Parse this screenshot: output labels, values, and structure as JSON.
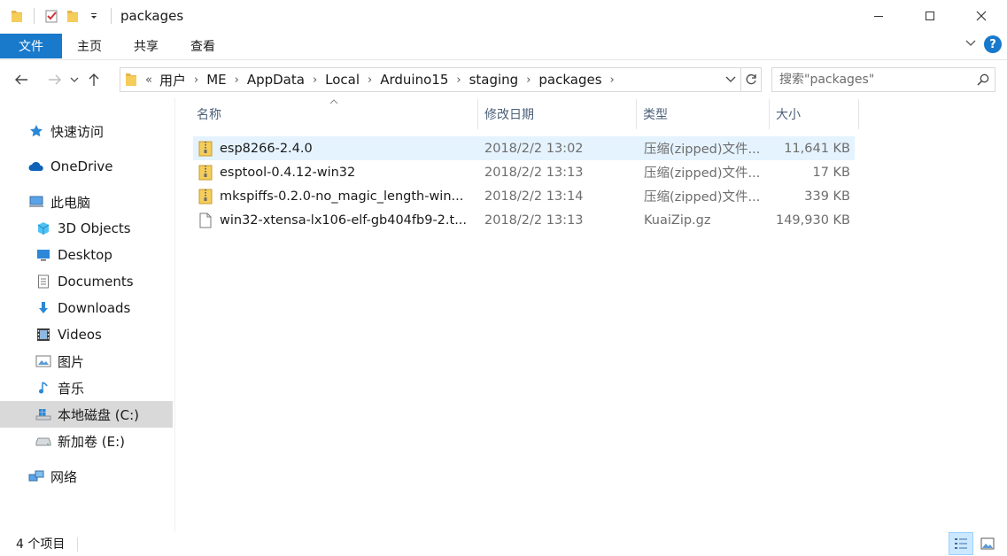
{
  "window": {
    "title": "packages"
  },
  "ribbon": {
    "tabs": [
      {
        "label": "文件"
      },
      {
        "label": "主页"
      },
      {
        "label": "共享"
      },
      {
        "label": "查看"
      }
    ],
    "help_label": "?"
  },
  "address": {
    "overflow": "«",
    "crumbs": [
      "用户",
      "ME",
      "AppData",
      "Local",
      "Arduino15",
      "staging",
      "packages"
    ]
  },
  "search": {
    "placeholder": "搜索\"packages\""
  },
  "sidebar": {
    "items": [
      {
        "label": "快速访问",
        "icon": "star-icon"
      },
      {
        "label": "OneDrive",
        "icon": "cloud-icon"
      },
      {
        "label": "此电脑",
        "icon": "computer-icon"
      },
      {
        "label": "3D Objects",
        "icon": "cube-icon"
      },
      {
        "label": "Desktop",
        "icon": "desktop-icon"
      },
      {
        "label": "Documents",
        "icon": "document-icon"
      },
      {
        "label": "Downloads",
        "icon": "download-icon"
      },
      {
        "label": "Videos",
        "icon": "film-icon"
      },
      {
        "label": "图片",
        "icon": "picture-icon"
      },
      {
        "label": "音乐",
        "icon": "music-icon"
      },
      {
        "label": "本地磁盘 (C:)",
        "icon": "windows-drive-icon"
      },
      {
        "label": "新加卷 (E:)",
        "icon": "drive-icon"
      },
      {
        "label": "网络",
        "icon": "network-icon"
      }
    ]
  },
  "columns": {
    "name": "名称",
    "date": "修改日期",
    "type": "类型",
    "size": "大小"
  },
  "files": [
    {
      "name": "esp8266-2.4.0",
      "date": "2018/2/2 13:02",
      "type": "压缩(zipped)文件...",
      "size": "11,641 KB",
      "icon": "zip-folder-icon"
    },
    {
      "name": "esptool-0.4.12-win32",
      "date": "2018/2/2 13:13",
      "type": "压缩(zipped)文件...",
      "size": "17 KB",
      "icon": "zip-folder-icon"
    },
    {
      "name": "mkspiffs-0.2.0-no_magic_length-win...",
      "date": "2018/2/2 13:14",
      "type": "压缩(zipped)文件...",
      "size": "339 KB",
      "icon": "zip-folder-icon"
    },
    {
      "name": "win32-xtensa-lx106-elf-gb404fb9-2.t...",
      "date": "2018/2/2 13:13",
      "type": "KuaiZip.gz",
      "size": "149,930 KB",
      "icon": "file-icon"
    }
  ],
  "status": {
    "count": "4 个项目"
  },
  "colors": {
    "accent": "#1979ca",
    "hover_row": "#e5f3ff",
    "selected_nav": "#d9d9d9"
  }
}
